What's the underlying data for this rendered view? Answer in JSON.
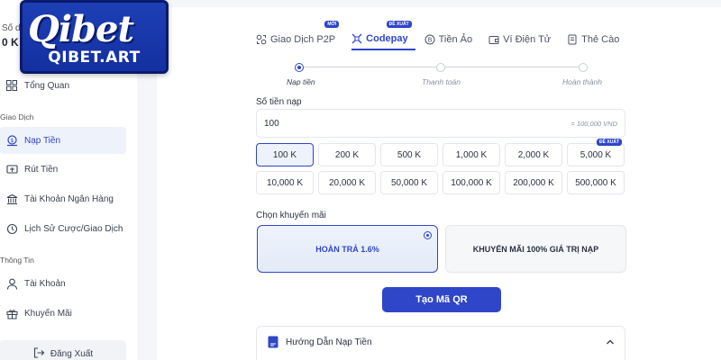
{
  "brand": {
    "logo_main": "Qibet",
    "logo_sub": "QIBET.ART"
  },
  "balance": {
    "label": "Số dư",
    "value": "0 K"
  },
  "sidebar": {
    "overview": "Tổng Quan",
    "section_transactions": "Giao Dịch",
    "items": [
      {
        "label": "Nạp Tiền",
        "icon": "coin-icon",
        "active": true
      },
      {
        "label": "Rút Tiền",
        "icon": "withdraw-icon"
      },
      {
        "label": "Tài Khoản Ngân Hàng",
        "icon": "bank-icon"
      },
      {
        "label": "Lịch Sử Cược/Giao Dịch",
        "icon": "history-icon"
      }
    ],
    "section_info": "Thông Tin",
    "info_items": [
      {
        "label": "Tài Khoản",
        "icon": "user-icon"
      },
      {
        "label": "Khuyến Mãi",
        "icon": "gift-icon"
      }
    ],
    "logout": "Đăng Xuất"
  },
  "tabs": [
    {
      "label": "Giao Dịch P2P",
      "badge": "MỚI",
      "icon": "p2p-icon"
    },
    {
      "label": "Codepay",
      "badge": "ĐỀ XUẤT",
      "icon": "codepay-icon",
      "active": true
    },
    {
      "label": "Tiền Ảo",
      "icon": "crypto-icon"
    },
    {
      "label": "Ví Điện Tử",
      "icon": "wallet-icon"
    },
    {
      "label": "Thẻ Cào",
      "icon": "card-icon"
    }
  ],
  "steps": [
    "Nạp tiền",
    "Thanh toán",
    "Hoàn thành"
  ],
  "current_step": 1,
  "amount": {
    "label": "Số tiền nạp",
    "value": "100",
    "converted": "= 100,000 VND"
  },
  "quick_amounts": [
    {
      "label": "100 K",
      "selected": true
    },
    {
      "label": "200 K"
    },
    {
      "label": "500 K"
    },
    {
      "label": "1,000 K"
    },
    {
      "label": "2,000 K"
    },
    {
      "label": "5,000 K",
      "badge": "ĐỀ XUẤT"
    },
    {
      "label": "10,000 K"
    },
    {
      "label": "20,000 K"
    },
    {
      "label": "50,000 K"
    },
    {
      "label": "100,000 K"
    },
    {
      "label": "200,000 K"
    },
    {
      "label": "500,000 K"
    }
  ],
  "promo": {
    "label": "Chọn khuyến mãi",
    "options": [
      {
        "label": "HOÀN TRẢ 1.6%",
        "selected": true
      },
      {
        "label": "KHUYẾN MÃI 100% GIÁ TRỊ NẠP"
      }
    ]
  },
  "submit_label": "Tạo Mã QR",
  "guide_label": "Hướng Dẫn Nạp Tiền",
  "colors": {
    "accent": "#2f46c9",
    "brand": "#1d3fb5"
  }
}
